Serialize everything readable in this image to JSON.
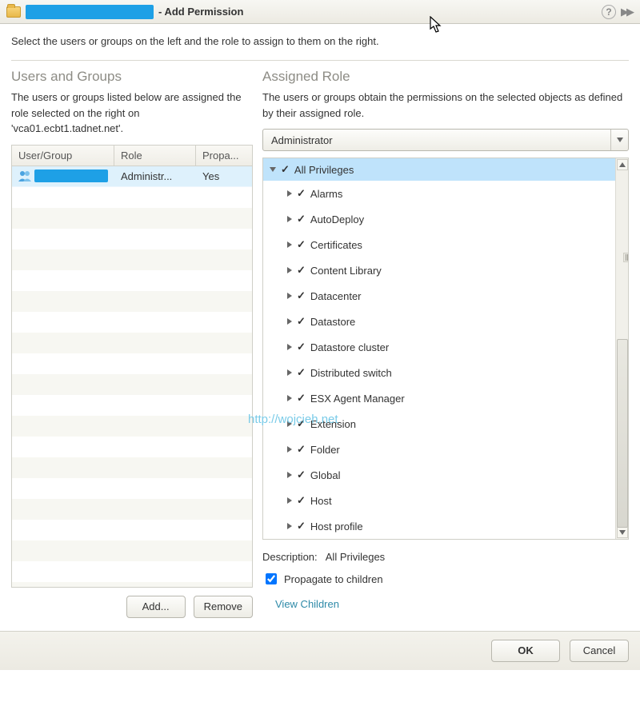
{
  "title": {
    "suffix": "- Add Permission"
  },
  "instruction": "Select the users or groups on the left and the role to assign to them on the right.",
  "left": {
    "heading": "Users and Groups",
    "desc": "The users or groups listed below are assigned the role selected on the right on 'vca01.ecbt1.tadnet.net'.",
    "columns": {
      "c1": "User/Group",
      "c2": "Role",
      "c3": "Propa..."
    },
    "row": {
      "role": "Administr...",
      "propagate": "Yes"
    },
    "add": "Add...",
    "remove": "Remove"
  },
  "right": {
    "heading": "Assigned Role",
    "desc": "The users or groups obtain the permissions on the selected objects as defined by their assigned role.",
    "role": "Administrator",
    "root": "All Privileges",
    "privs": [
      "Alarms",
      "AutoDeploy",
      "Certificates",
      "Content Library",
      "Datacenter",
      "Datastore",
      "Datastore cluster",
      "Distributed switch",
      "ESX Agent Manager",
      "Extension",
      "Folder",
      "Global",
      "Host",
      "Host profile"
    ],
    "desc_label": "Description:",
    "desc_value": "All Privileges",
    "propagate": "Propagate to children",
    "view_children": "View Children"
  },
  "footer": {
    "ok": "OK",
    "cancel": "Cancel"
  },
  "watermark": "http://wojcieh.net"
}
